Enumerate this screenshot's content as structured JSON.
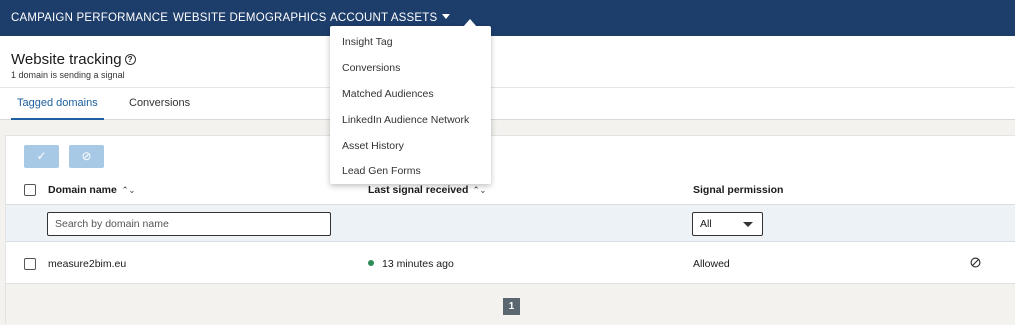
{
  "topnav": {
    "items": [
      {
        "label": "CAMPAIGN PERFORMANCE"
      },
      {
        "label": "WEBSITE DEMOGRAPHICS"
      },
      {
        "label": "ACCOUNT ASSETS"
      }
    ]
  },
  "dropdown": {
    "items": [
      {
        "label": "Insight Tag"
      },
      {
        "label": "Conversions"
      },
      {
        "label": "Matched Audiences"
      },
      {
        "label": "LinkedIn Audience Network"
      },
      {
        "label": "Asset History"
      },
      {
        "label": "Lead Gen Forms"
      }
    ]
  },
  "header": {
    "title": "Website tracking",
    "help_glyph": "?",
    "subtitle": "1 domain is sending a signal"
  },
  "tabs": [
    {
      "label": "Tagged domains",
      "active": true
    },
    {
      "label": "Conversions",
      "active": false
    }
  ],
  "toolbar": {
    "approve_glyph": "✓",
    "block_glyph": "⊘"
  },
  "table": {
    "columns": [
      {
        "label": "Domain name",
        "sortable": true
      },
      {
        "label": "Last signal received",
        "sortable": true
      },
      {
        "label": "Signal permission",
        "sortable": false
      }
    ],
    "search_placeholder": "Search by domain name",
    "permission_filter": "All",
    "rows": [
      {
        "domain": "measure2bim.eu",
        "last_signal": "13 minutes ago",
        "permission": "Allowed"
      }
    ]
  },
  "pagination": {
    "current_page": "1"
  },
  "colors": {
    "nav_bg": "#1d3d6b",
    "accent": "#1d5fa0",
    "status_active": "#2e8b57"
  }
}
